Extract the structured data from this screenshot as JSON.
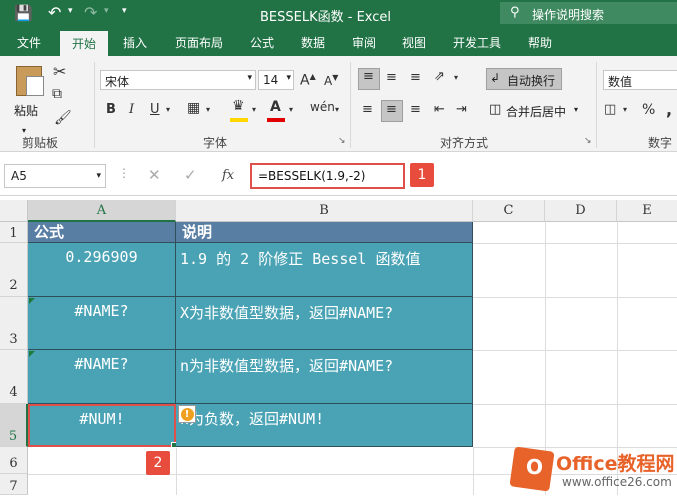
{
  "app": {
    "title": "BESSELK函数 - Excel",
    "search_placeholder": "操作说明搜索"
  },
  "tabs": [
    "文件",
    "开始",
    "插入",
    "页面布局",
    "公式",
    "数据",
    "审阅",
    "视图",
    "开发工具",
    "帮助"
  ],
  "ribbon": {
    "clipboard": {
      "label": "剪贴板",
      "paste": "粘贴"
    },
    "font": {
      "label": "字体",
      "name": "宋体",
      "size": "14",
      "bold": "B",
      "italic": "I",
      "underline": "U"
    },
    "alignment": {
      "label": "对齐方式",
      "wrap": "自动换行",
      "merge": "合并后居中"
    },
    "number": {
      "label": "数字",
      "format": "数值",
      "percent": "%",
      "comma": ","
    }
  },
  "formula_bar": {
    "name_box": "A5",
    "fx": "fx",
    "formula": "=BESSELK(1.9,-2)",
    "badge": "1"
  },
  "sheet": {
    "columns": [
      "A",
      "B",
      "C",
      "D",
      "E"
    ],
    "rows": [
      "1",
      "2",
      "3",
      "4",
      "5",
      "6",
      "7"
    ],
    "header": {
      "a": "公式",
      "b": "说明"
    },
    "data": [
      {
        "a": "0.296909",
        "b": "1.9 的 2 阶修正 Bessel 函数值"
      },
      {
        "a": "#NAME?",
        "b": "X为非数值型数据，返回#NAME?"
      },
      {
        "a": "#NAME?",
        "b": "n为非数值型数据，返回#NAME?"
      },
      {
        "a": "#NUM!",
        "b": "n为负数，返回#NUM!"
      }
    ],
    "selected_badge": "2"
  },
  "watermark": {
    "brand": "Office教程网",
    "url": "www.office26.com"
  }
}
